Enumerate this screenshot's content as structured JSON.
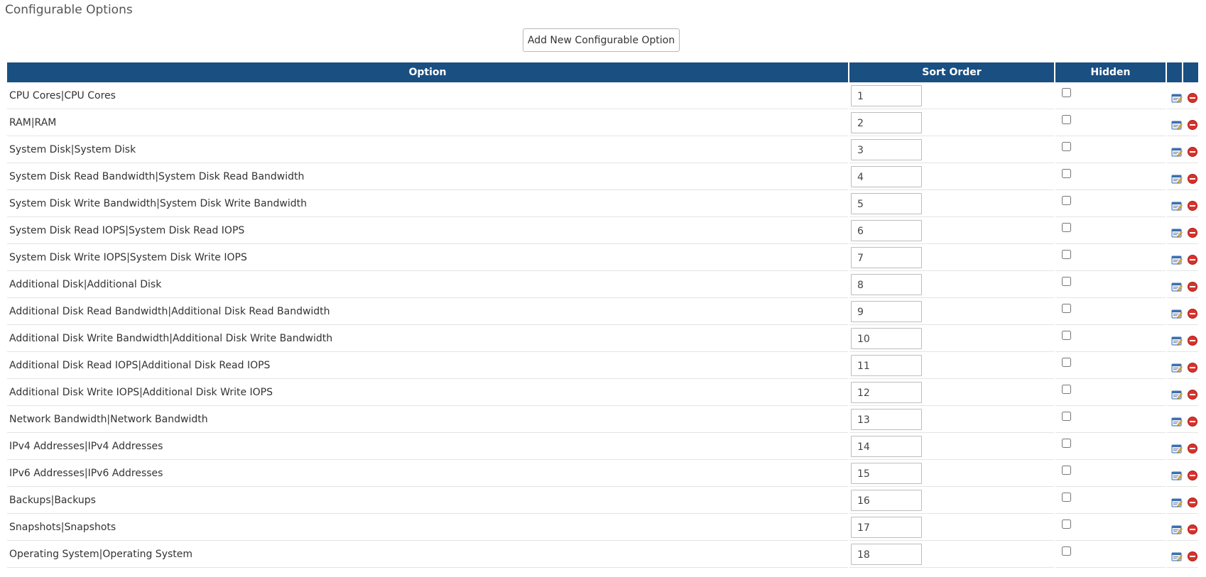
{
  "page": {
    "title": "Configurable Options",
    "add_button_label": "Add New Configurable Option"
  },
  "table": {
    "columns": [
      "Option",
      "Sort Order",
      "Hidden",
      "",
      ""
    ],
    "rows": [
      {
        "option": "CPU Cores|CPU Cores",
        "sort_order": "1",
        "hidden": false
      },
      {
        "option": "RAM|RAM",
        "sort_order": "2",
        "hidden": false
      },
      {
        "option": "System Disk|System Disk",
        "sort_order": "3",
        "hidden": false
      },
      {
        "option": "System Disk Read Bandwidth|System Disk Read Bandwidth",
        "sort_order": "4",
        "hidden": false
      },
      {
        "option": "System Disk Write Bandwidth|System Disk Write Bandwidth",
        "sort_order": "5",
        "hidden": false
      },
      {
        "option": "System Disk Read IOPS|System Disk Read IOPS",
        "sort_order": "6",
        "hidden": false
      },
      {
        "option": "System Disk Write IOPS|System Disk Write IOPS",
        "sort_order": "7",
        "hidden": false
      },
      {
        "option": "Additional Disk|Additional Disk",
        "sort_order": "8",
        "hidden": false
      },
      {
        "option": "Additional Disk Read Bandwidth|Additional Disk Read Bandwidth",
        "sort_order": "9",
        "hidden": false
      },
      {
        "option": "Additional Disk Write Bandwidth|Additional Disk Write Bandwidth",
        "sort_order": "10",
        "hidden": false
      },
      {
        "option": "Additional Disk Read IOPS|Additional Disk Read IOPS",
        "sort_order": "11",
        "hidden": false
      },
      {
        "option": "Additional Disk Write IOPS|Additional Disk Write IOPS",
        "sort_order": "12",
        "hidden": false
      },
      {
        "option": "Network Bandwidth|Network Bandwidth",
        "sort_order": "13",
        "hidden": false
      },
      {
        "option": "IPv4 Addresses|IPv4 Addresses",
        "sort_order": "14",
        "hidden": false
      },
      {
        "option": "IPv6 Addresses|IPv6 Addresses",
        "sort_order": "15",
        "hidden": false
      },
      {
        "option": "Backups|Backups",
        "sort_order": "16",
        "hidden": false
      },
      {
        "option": "Snapshots|Snapshots",
        "sort_order": "17",
        "hidden": false
      },
      {
        "option": "Operating System|Operating System",
        "sort_order": "18",
        "hidden": false
      }
    ]
  },
  "icons": {
    "edit": "edit-icon",
    "delete": "delete-icon"
  },
  "colors": {
    "header_bg": "#1a4f82",
    "header_text": "#ffffff",
    "delete_red": "#d9322b",
    "edit_blue": "#3b6fb0"
  }
}
